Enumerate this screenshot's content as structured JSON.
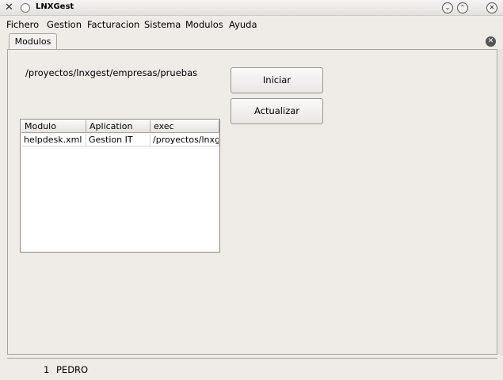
{
  "window": {
    "title": "LNXGest",
    "app_icon": "x-tools-icon",
    "minimize": "⌄",
    "maximize": "⌃",
    "close": "✕"
  },
  "menubar": {
    "items": [
      "Fichero",
      "Gestion",
      "Facturacion",
      "Sistema",
      "Modulos",
      "Ayuda"
    ]
  },
  "tab": {
    "label": "Modulos",
    "close": "✕"
  },
  "content": {
    "path": "/proyectos/lnxgest/empresas/pruebas",
    "buttons": {
      "iniciar": "Iniciar",
      "actualizar": "Actualizar"
    },
    "table": {
      "columns": [
        "Modulo",
        "Aplication",
        "exec"
      ],
      "rows": [
        [
          "helpdesk.xml",
          "Gestion IT",
          "/proyectos/lnxgest"
        ]
      ]
    }
  },
  "statusbar": {
    "number": "1",
    "user": "PEDRO"
  }
}
